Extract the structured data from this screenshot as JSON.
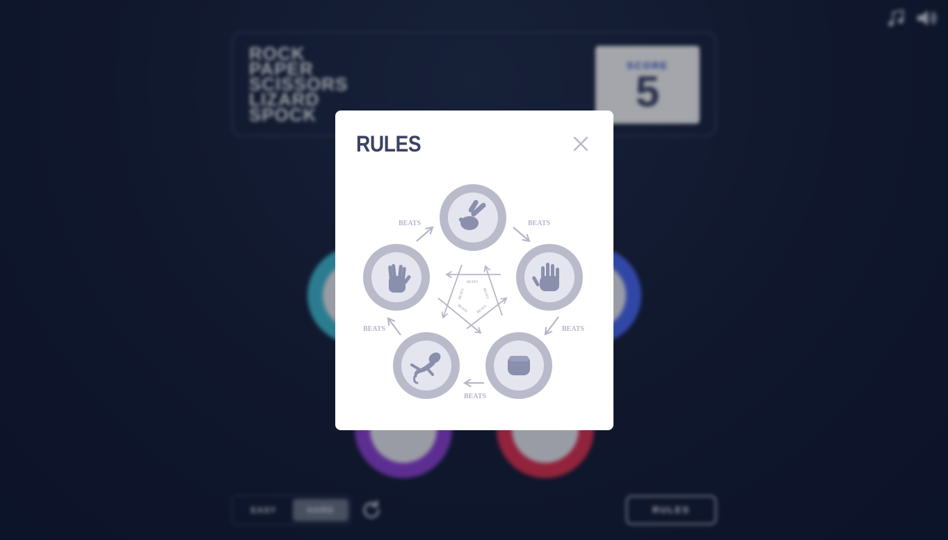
{
  "header": {
    "title_words": [
      "ROCK",
      "PAPER",
      "SCISSORS",
      "LIZARD",
      "SPOCK"
    ],
    "score_label": "SCORE",
    "score_value": "5"
  },
  "controls": {
    "mode_easy": "EASY",
    "mode_hard": "HARD",
    "rules_button": "RULES",
    "music_icon": "music-note-icon",
    "sound_icon": "speaker-icon",
    "reset_icon": "refresh-icon"
  },
  "modal": {
    "title": "RULES",
    "close_icon": "close-icon",
    "beats_label": "BEATS",
    "choices": [
      "scissors",
      "paper",
      "rock",
      "lizard",
      "spock"
    ]
  },
  "colors": {
    "title_text": "#3b4363",
    "diagram_ring": "#b9bbcb",
    "diagram_inner": "#e4e5ee",
    "diagram_icon": "#8a8fad",
    "score_label": "#2a46c0",
    "token_cyan": "#3fb7cd",
    "token_blue": "#4866f0",
    "token_purple": "#8b3fd0",
    "token_red": "#dc2e4e"
  }
}
